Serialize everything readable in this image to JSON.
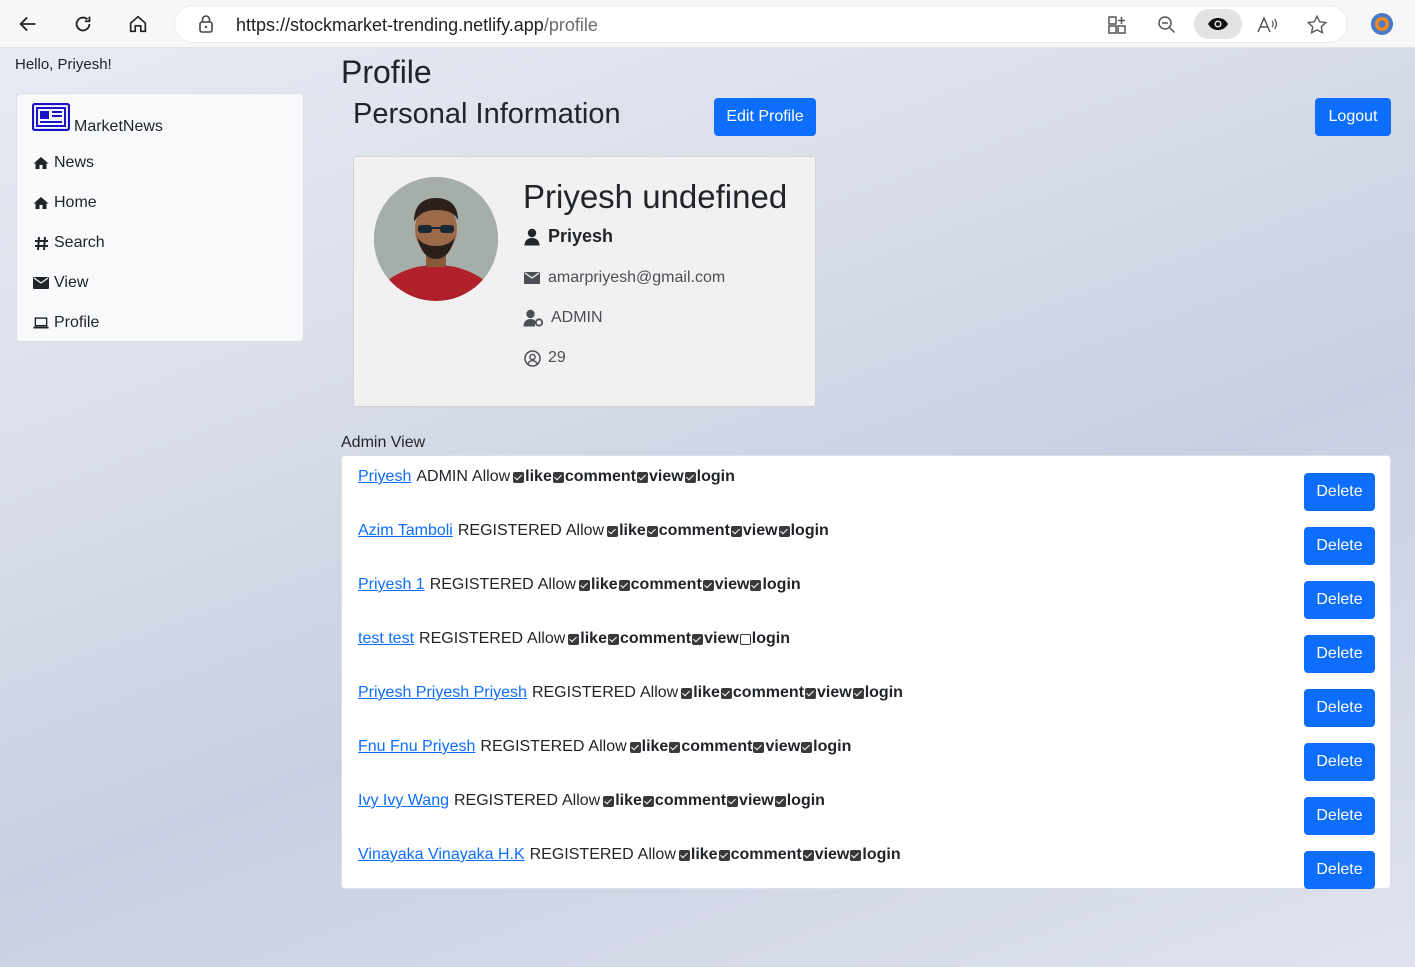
{
  "browser": {
    "url_host": "https://stockmarket-trending.netlify.app",
    "url_path": "/profile"
  },
  "greeting": "Hello, Priyesh!",
  "sidebar": {
    "brand": "MarketNews",
    "items": [
      {
        "label": "News",
        "icon": "home-icon"
      },
      {
        "label": "Home",
        "icon": "home-icon"
      },
      {
        "label": "Search",
        "icon": "hashtag-icon"
      },
      {
        "label": "View",
        "icon": "envelope-icon"
      },
      {
        "label": "Profile",
        "icon": "laptop-icon"
      }
    ]
  },
  "main": {
    "page_title": "Profile",
    "section_title": "Personal Information",
    "edit_label": "Edit Profile",
    "logout_label": "Logout"
  },
  "profile": {
    "full_name": "Priyesh undefined",
    "username": "Priyesh",
    "email": "amarpriyesh@gmail.com",
    "role": "ADMIN",
    "age": "29"
  },
  "admin": {
    "label": "Admin View",
    "allow_label": "Allow",
    "delete_label": "Delete",
    "perm_labels": [
      "like",
      "comment",
      "view",
      "login"
    ],
    "users": [
      {
        "name": "Priyesh",
        "role": "ADMIN",
        "perms": [
          true,
          true,
          true,
          true
        ]
      },
      {
        "name": "Azim Tamboli",
        "role": "REGISTERED",
        "perms": [
          true,
          true,
          true,
          true
        ]
      },
      {
        "name": "Priyesh 1",
        "role": "REGISTERED",
        "perms": [
          true,
          true,
          true,
          true
        ]
      },
      {
        "name": "test test",
        "role": "REGISTERED",
        "perms": [
          true,
          true,
          true,
          false
        ]
      },
      {
        "name": "Priyesh Priyesh Priyesh",
        "role": "REGISTERED",
        "perms": [
          true,
          true,
          true,
          true
        ]
      },
      {
        "name": "Fnu Fnu Priyesh",
        "role": "REGISTERED",
        "perms": [
          true,
          true,
          true,
          true
        ]
      },
      {
        "name": "Ivy Ivy Wang",
        "role": "REGISTERED",
        "perms": [
          true,
          true,
          true,
          true
        ]
      },
      {
        "name": "Vinayaka Vinayaka H.K",
        "role": "REGISTERED",
        "perms": [
          true,
          true,
          true,
          true
        ]
      }
    ]
  },
  "colors": {
    "primary": "#0d6efd",
    "brand_icon": "#1a12c9"
  }
}
